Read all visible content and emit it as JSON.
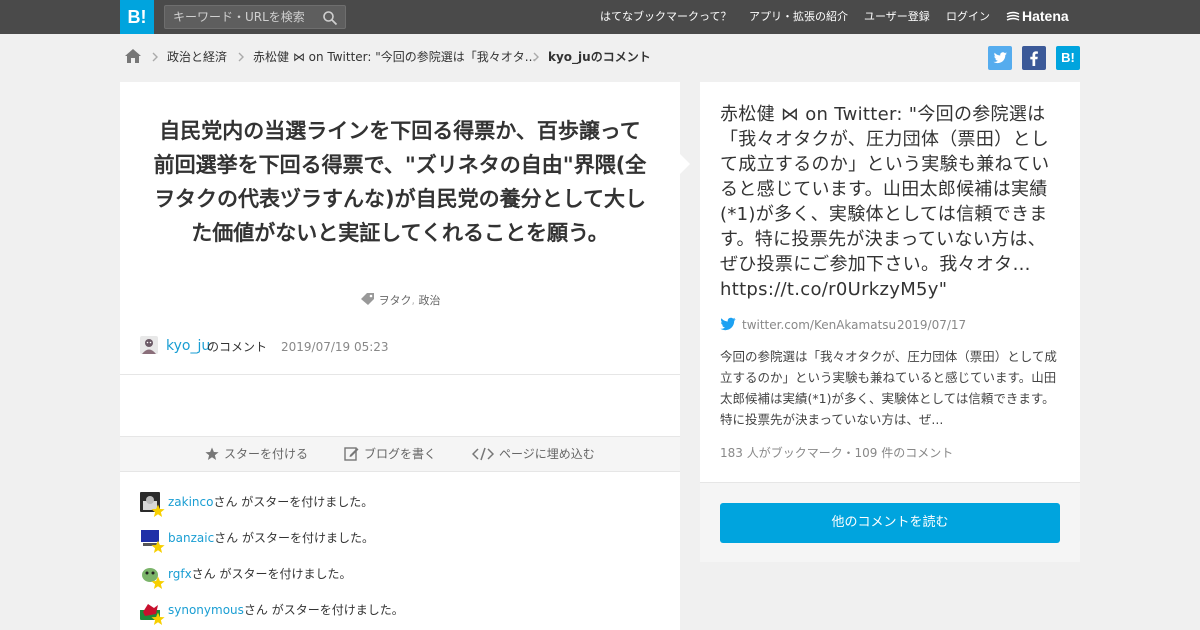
{
  "header": {
    "logo_text": "B!",
    "search_placeholder": "キーワード・URLを検索",
    "nav": [
      "はてなブックマークって？",
      "アプリ・拡張の紹介",
      "ユーザー登録",
      "ログイン"
    ],
    "brand": "Hatena"
  },
  "breadcrumb": {
    "items": [
      "政治と経済",
      "赤松健 ⋈ on Twitter: \"今回の参院選は「我々オタ...",
      "kyo_juのコメント"
    ]
  },
  "share": {
    "twitter": "t",
    "facebook": "f",
    "hatena": "B!"
  },
  "comment": {
    "text": "自民党内の当選ラインを下回る得票か、百歩譲って前回選挙を下回る得票で、\"ズリネタの自由\"界隈(全ヲタクの代表ヅラすんな)が自民党の養分として大した価値がないと実証してくれることを願う。",
    "tags": [
      "ヲタク",
      "政治"
    ],
    "user": "kyo_ju",
    "user_suffix": "のコメント",
    "date": "2019/07/19 05:23"
  },
  "actions": {
    "star": "スターを付ける",
    "blog": "ブログを書く",
    "embed": "ページに埋め込む"
  },
  "stars": [
    {
      "user": "zakinco",
      "text": "さん がスターを付けました。"
    },
    {
      "user": "banzaic",
      "text": "さん がスターを付けました。"
    },
    {
      "user": "rgfx",
      "text": "さん がスターを付けました。"
    },
    {
      "user": "synonymous",
      "text": "さん がスターを付けました。"
    }
  ],
  "entry": {
    "title": "赤松健 ⋈ on Twitter: \"今回の参院選は「我々オタクが、圧力団体（票田）として成立するのか」という実験も兼ねていると感じています。山田太郎候補は実績(*1)が多く、実験体としては信頼できます。特に投票先が決まっていない方は、ぜひ投票にご参加下さい。我々オタ… https://t.co/r0UrkzyM5y\"",
    "source": "twitter.com/KenAkamatsu",
    "date": "2019/07/17",
    "description": "今回の参院選は「我々オタクが、圧力団体（票田）として成立するのか」という実験も兼ねていると感じています。山田太郎候補は実績(*1)が多く、実験体としては信頼できます。特に投票先が決まっていない方は、ぜ...",
    "count": "183 人がブックマーク・109 件のコメント",
    "more_button": "他のコメントを読む"
  },
  "colors": {
    "accent": "#00a4de",
    "link": "#1a9ed3",
    "twitter": "#55acee",
    "facebook": "#3b5998",
    "star": "#f7cf00"
  }
}
